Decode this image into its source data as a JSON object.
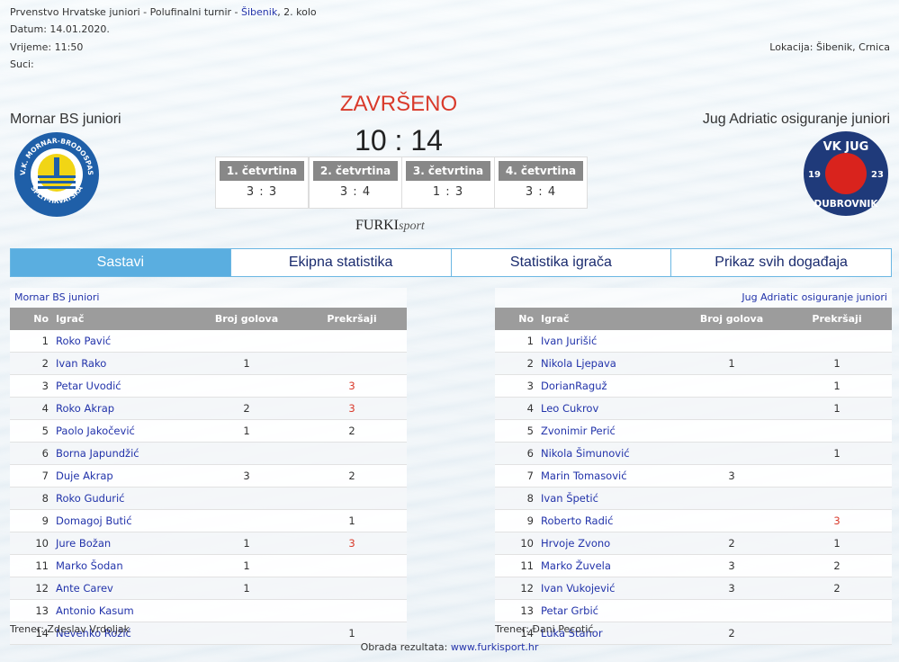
{
  "header": {
    "competition": "Prvenstvo Hrvatske juniori - Polufinalni turnir - ",
    "venue_link": "Šibenik",
    "round": ", 2. kolo",
    "date": "Datum: 14.01.2020.",
    "time": "Vrijeme: 11:50",
    "referees": "Suci:",
    "location": "Lokacija: Šibenik, Crnica"
  },
  "match": {
    "status": "ZAVRŠENO",
    "score": "10 : 14",
    "home_team": "Mornar BS juniori",
    "away_team": "Jug Adriatic osiguranje juniori",
    "quarters": [
      {
        "label": "1. četvrtina",
        "score": "3 : 3"
      },
      {
        "label": "2. četvrtina",
        "score": "3 : 4"
      },
      {
        "label": "3. četvrtina",
        "score": "1 : 3"
      },
      {
        "label": "4. četvrtina",
        "score": "3 : 4"
      }
    ]
  },
  "home_logo": {
    "text_top": "V.K. MORNAR-BRODOSPAS",
    "text_bottom": "SPLIT-HRVATSKA",
    "color": "#1f5fa8"
  },
  "away_logo": {
    "text_top": "VK JUG",
    "left_num": "19",
    "right_num": "23",
    "text_bottom": "DUBROVNIK",
    "color": "#1f3a7a",
    "dot_color": "#d9231d"
  },
  "brand": {
    "furki": "FURKI",
    "sport": "sport"
  },
  "tabs": [
    "Sastavi",
    "Ekipna statistika",
    "Statistika igrača",
    "Prikaz svih događaja"
  ],
  "columns": {
    "no": "No",
    "player": "Igrač",
    "goals": "Broj golova",
    "fouls": "Prekršaji"
  },
  "home_roster": {
    "team": "Mornar BS juniori",
    "trainer": "Trener: Zdeslav Vrdoljak",
    "players": [
      {
        "no": "1",
        "name": "Roko Pavić",
        "goals": "",
        "fouls": "",
        "fouls_red": false
      },
      {
        "no": "2",
        "name": "Ivan Rako",
        "goals": "1",
        "fouls": "",
        "fouls_red": false
      },
      {
        "no": "3",
        "name": "Petar Uvodić",
        "goals": "",
        "fouls": "3",
        "fouls_red": true
      },
      {
        "no": "4",
        "name": "Roko Akrap",
        "goals": "2",
        "fouls": "3",
        "fouls_red": true
      },
      {
        "no": "5",
        "name": "Paolo Jakočević",
        "goals": "1",
        "fouls": "2",
        "fouls_red": false
      },
      {
        "no": "6",
        "name": "Borna Japundžić",
        "goals": "",
        "fouls": "",
        "fouls_red": false
      },
      {
        "no": "7",
        "name": "Duje Akrap",
        "goals": "3",
        "fouls": "2",
        "fouls_red": false
      },
      {
        "no": "8",
        "name": "Roko Gudurić",
        "goals": "",
        "fouls": "",
        "fouls_red": false
      },
      {
        "no": "9",
        "name": "Domagoj Butić",
        "goals": "",
        "fouls": "1",
        "fouls_red": false
      },
      {
        "no": "10",
        "name": "Jure Božan",
        "goals": "1",
        "fouls": "3",
        "fouls_red": true
      },
      {
        "no": "11",
        "name": "Marko Šodan",
        "goals": "1",
        "fouls": "",
        "fouls_red": false
      },
      {
        "no": "12",
        "name": "Ante Carev",
        "goals": "1",
        "fouls": "",
        "fouls_red": false
      },
      {
        "no": "13",
        "name": "Antonio Kasum",
        "goals": "",
        "fouls": "",
        "fouls_red": false
      },
      {
        "no": "14",
        "name": "Nevenko Rožić",
        "goals": "",
        "fouls": "1",
        "fouls_red": false
      }
    ]
  },
  "away_roster": {
    "team": "Jug Adriatic osiguranje juniori",
    "trainer": "Trener: Đani Pecotić",
    "players": [
      {
        "no": "1",
        "name": "Ivan Jurišić",
        "goals": "",
        "fouls": "",
        "fouls_red": false
      },
      {
        "no": "2",
        "name": "Nikola Ljepava",
        "goals": "1",
        "fouls": "1",
        "fouls_red": false
      },
      {
        "no": "3",
        "name": "DorianRaguž",
        "goals": "",
        "fouls": "1",
        "fouls_red": false
      },
      {
        "no": "4",
        "name": "Leo Cukrov",
        "goals": "",
        "fouls": "1",
        "fouls_red": false
      },
      {
        "no": "5",
        "name": "Zvonimir Perić",
        "goals": "",
        "fouls": "",
        "fouls_red": false
      },
      {
        "no": "6",
        "name": "Nikola Šimunović",
        "goals": "",
        "fouls": "1",
        "fouls_red": false
      },
      {
        "no": "7",
        "name": "Marin Tomasović",
        "goals": "3",
        "fouls": "",
        "fouls_red": false
      },
      {
        "no": "8",
        "name": "Ivan Špetić",
        "goals": "",
        "fouls": "",
        "fouls_red": false
      },
      {
        "no": "9",
        "name": "Roberto Radić",
        "goals": "",
        "fouls": "3",
        "fouls_red": true
      },
      {
        "no": "10",
        "name": "Hrvoje Zvono",
        "goals": "2",
        "fouls": "1",
        "fouls_red": false
      },
      {
        "no": "11",
        "name": "Marko Žuvela",
        "goals": "3",
        "fouls": "2",
        "fouls_red": false
      },
      {
        "no": "12",
        "name": "Ivan Vukojević",
        "goals": "3",
        "fouls": "2",
        "fouls_red": false
      },
      {
        "no": "13",
        "name": "Petar Grbić",
        "goals": "",
        "fouls": "",
        "fouls_red": false
      },
      {
        "no": "14",
        "name": "Luka Stahor",
        "goals": "2",
        "fouls": "",
        "fouls_red": false
      }
    ]
  },
  "footer": {
    "label": "Obrada rezultata: ",
    "link": "www.furkisport.hr"
  }
}
